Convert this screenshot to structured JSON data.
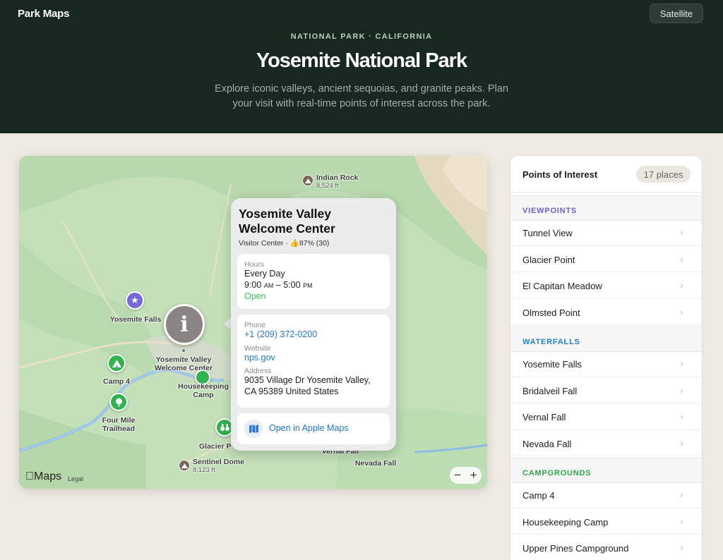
{
  "header": {
    "brand": "Park Maps",
    "satellite_label": "Satellite",
    "eyebrow": "NATIONAL PARK · CALIFORNIA",
    "title": "Yosemite National Park",
    "description": "Explore iconic valleys, ancient sequoias, and granite peaks. Plan your visit with real-time points of interest across the park."
  },
  "map": {
    "markers": {
      "indian_rock": {
        "name": "Indian Rock",
        "elev": "8,524 ft"
      },
      "yosemite_falls": "Yosemite Falls",
      "camp4": "Camp 4",
      "four_mile_1": "Four Mile",
      "four_mile_2": "Trailhead",
      "welcome_1": "Yosemite Valley",
      "welcome_2": "Welcome Center",
      "housekeeping_1": "Housekeeping",
      "housekeeping_2": "Camp",
      "glacier": "Glacier P",
      "sentinel": {
        "name": "Sentinel Dome",
        "elev": "8,123 ft"
      },
      "vernal": "Vernal Fall",
      "nevada": "Nevada Fall"
    },
    "attribution": {
      "logo": "Maps",
      "legal": "Legal"
    },
    "zoom": {
      "minus": "−",
      "plus": "+"
    }
  },
  "popup": {
    "title": "Yosemite Valley Welcome Center",
    "category": "Visitor Center · ",
    "rating_icon": "thumbs-up-icon",
    "rating": "87% (30)",
    "hours": {
      "label": "Hours",
      "days": "Every Day",
      "open_time": "9:00",
      "open_ampm": "AM",
      "sep": " – ",
      "close_time": "5:00",
      "close_ampm": "PM",
      "status": "Open"
    },
    "phone": {
      "label": "Phone",
      "value": "+1 (209) 372-0200"
    },
    "website": {
      "label": "Website",
      "value": "nps.gov"
    },
    "address": {
      "label": "Address",
      "line1": "9035 Village Dr Yosemite Valley,",
      "line2": "CA 95389 United States"
    },
    "open_in_maps": "Open in Apple Maps"
  },
  "poi": {
    "title": "Points of Interest",
    "count": "17 places",
    "categories": [
      {
        "name": "VIEWPOINTS",
        "color": "#6e5fd0",
        "items": [
          "Tunnel View",
          "Glacier Point",
          "El Capitan Meadow",
          "Olmsted Point"
        ]
      },
      {
        "name": "WATERFALLS",
        "color": "#1f7fd0",
        "items": [
          "Yosemite Falls",
          "Bridalveil Fall",
          "Vernal Fall",
          "Nevada Fall"
        ]
      },
      {
        "name": "CAMPGROUNDS",
        "color": "#2fa44c",
        "items": [
          "Camp 4",
          "Housekeeping Camp",
          "Upper Pines Campground"
        ]
      }
    ]
  }
}
